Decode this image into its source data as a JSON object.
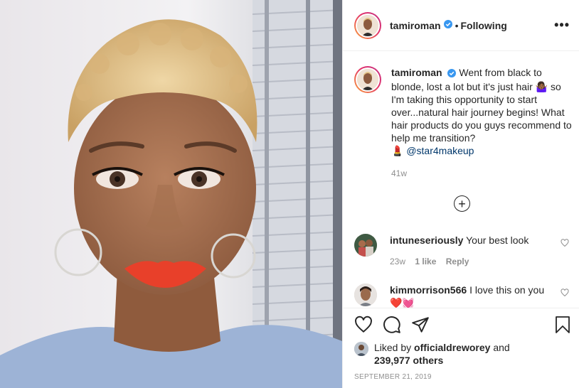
{
  "post": {
    "username": "tamiroman",
    "verified": true,
    "separator": "•",
    "follow_status": "Following",
    "more_icon": "more-horizontal-icon",
    "photo_description_icon": "post-photo"
  },
  "caption": {
    "username": "tamiroman",
    "text_1": "Went from black to blonde, lost a lot but it's just hair",
    "emoji_1": "🤷🏾‍♀️",
    "text_2": "so I'm taking this opportunity to start over...natural hair journey begins! What hair products do you guys recommend to help me transition?",
    "emoji_2": "💄",
    "mention": "@star4makeup",
    "time": "41w"
  },
  "load_more_icon": "plus-circle-icon",
  "comments": [
    {
      "username": "intuneseriously",
      "text": "Your best look",
      "time": "23w",
      "likes": "1 like",
      "reply": "Reply"
    },
    {
      "username": "kimmorrison566",
      "text": "I love this on you",
      "emoji": "❤️💓"
    }
  ],
  "actions": {
    "like_icon": "heart-icon",
    "comment_icon": "comment-icon",
    "share_icon": "paper-plane-icon",
    "save_icon": "bookmark-icon"
  },
  "likes": {
    "prefix": "Liked by",
    "user": "officialdreworey",
    "conj": "and",
    "count": "239,977 others"
  },
  "date": "SEPTEMBER 21, 2019",
  "colors": {
    "accent_link": "#00376b",
    "verified_blue": "#3897f0",
    "lipstick": "#e8402a",
    "hair_blonde": "#e3c489"
  }
}
